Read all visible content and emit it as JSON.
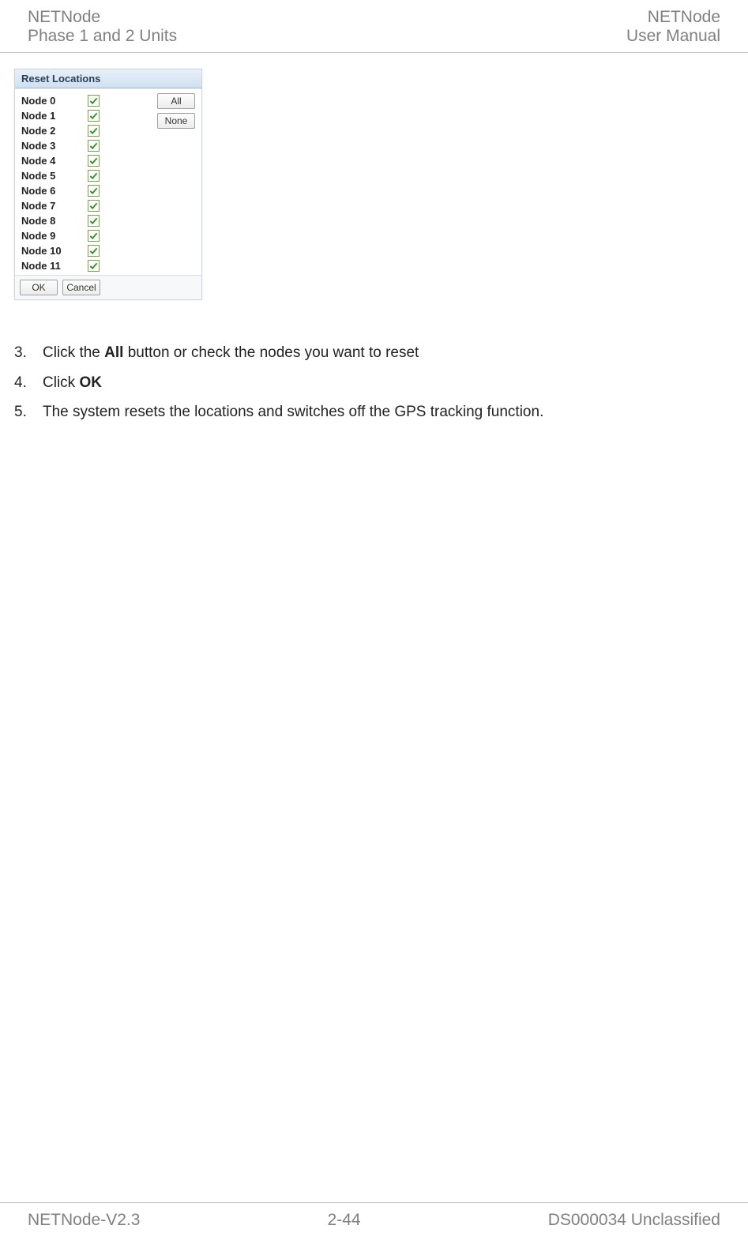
{
  "header": {
    "left_line1": "NETNode",
    "left_line2": "Phase 1 and 2 Units",
    "right_line1": "NETNode",
    "right_line2": "User Manual"
  },
  "dialog": {
    "title": "Reset Locations",
    "nodes": [
      {
        "label": "Node 0",
        "checked": true
      },
      {
        "label": "Node 1",
        "checked": true
      },
      {
        "label": "Node 2",
        "checked": true
      },
      {
        "label": "Node 3",
        "checked": true
      },
      {
        "label": "Node 4",
        "checked": true
      },
      {
        "label": "Node 5",
        "checked": true
      },
      {
        "label": "Node 6",
        "checked": true
      },
      {
        "label": "Node 7",
        "checked": true
      },
      {
        "label": "Node 8",
        "checked": true
      },
      {
        "label": "Node 9",
        "checked": true
      },
      {
        "label": "Node 10",
        "checked": true
      },
      {
        "label": "Node 11",
        "checked": true
      }
    ],
    "btn_all": "All",
    "btn_none": "None",
    "btn_ok": "OK",
    "btn_cancel": "Cancel"
  },
  "steps": [
    {
      "num": "3.",
      "prefix": "Click the ",
      "bold": "All",
      "suffix": " button or check the nodes you want to reset"
    },
    {
      "num": "4.",
      "prefix": "Click ",
      "bold": "OK",
      "suffix": ""
    },
    {
      "num": "5.",
      "prefix": "The system resets the locations and switches off the GPS tracking function.",
      "bold": "",
      "suffix": ""
    }
  ],
  "footer": {
    "left": "NETNode-V2.3",
    "center": "2-44",
    "right": "DS000034 Unclassified"
  }
}
